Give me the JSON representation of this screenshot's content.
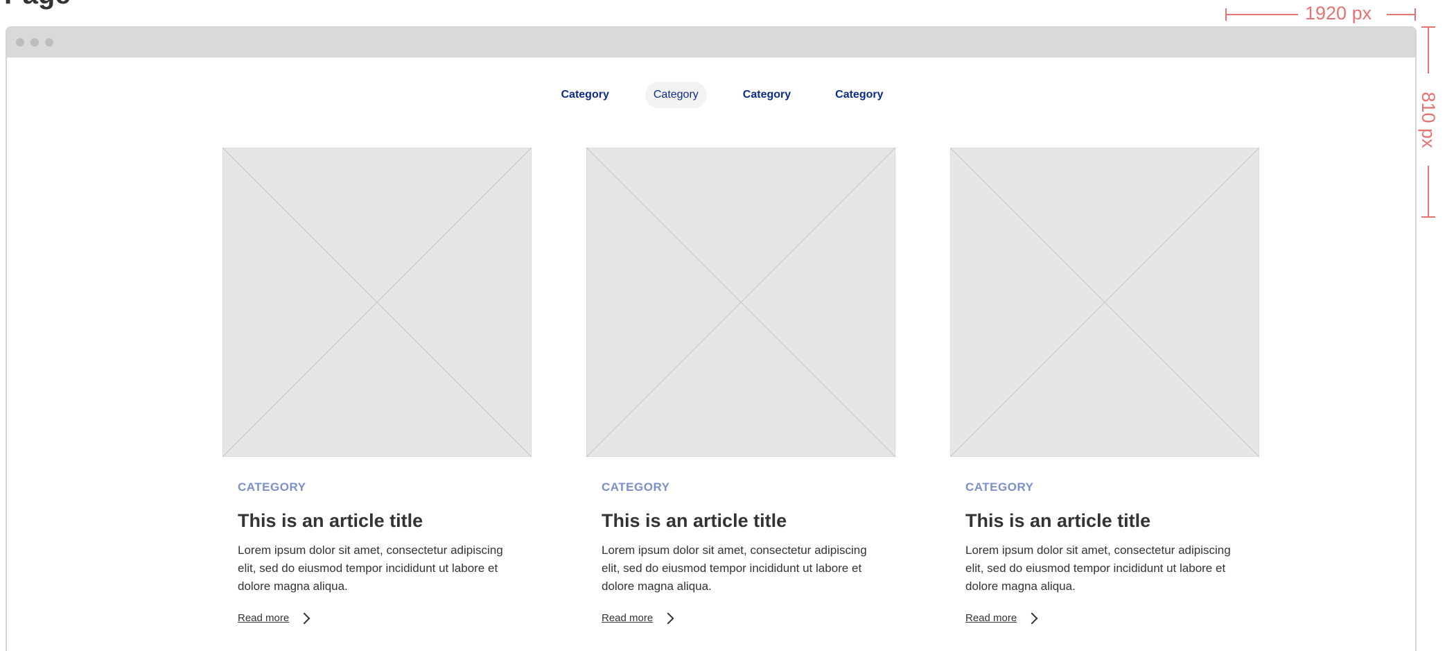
{
  "page": {
    "clipped_heading": "Page"
  },
  "dimensions": {
    "width_label": "1920 px",
    "height_label": "810 px"
  },
  "nav": {
    "items": [
      {
        "label": "Category"
      },
      {
        "label": "Category"
      },
      {
        "label": "Category"
      },
      {
        "label": "Category"
      }
    ],
    "active_index": 1
  },
  "cards": [
    {
      "category": "CATEGORY",
      "title": "This is an article title",
      "description": "Lorem ipsum dolor sit amet, consectetur adipiscing elit, sed do eiusmod tempor incididunt ut labore et dolore magna aliqua.",
      "read_more": "Read more"
    },
    {
      "category": "CATEGORY",
      "title": "This is an article title",
      "description": "Lorem ipsum dolor sit amet, consectetur adipiscing elit, sed do eiusmod tempor incididunt ut labore et dolore magna aliqua.",
      "read_more": "Read more"
    },
    {
      "category": "CATEGORY",
      "title": "This is an article title",
      "description": "Lorem ipsum dolor sit amet, consectetur adipiscing elit, sed do eiusmod tempor incididunt ut labore et dolore magna aliqua.",
      "read_more": "Read more"
    }
  ],
  "colors": {
    "nav_text": "#0d2a8f",
    "category_text": "#7b8fc9",
    "annotation": "#e57373",
    "placeholder": "#e6e6e6"
  }
}
